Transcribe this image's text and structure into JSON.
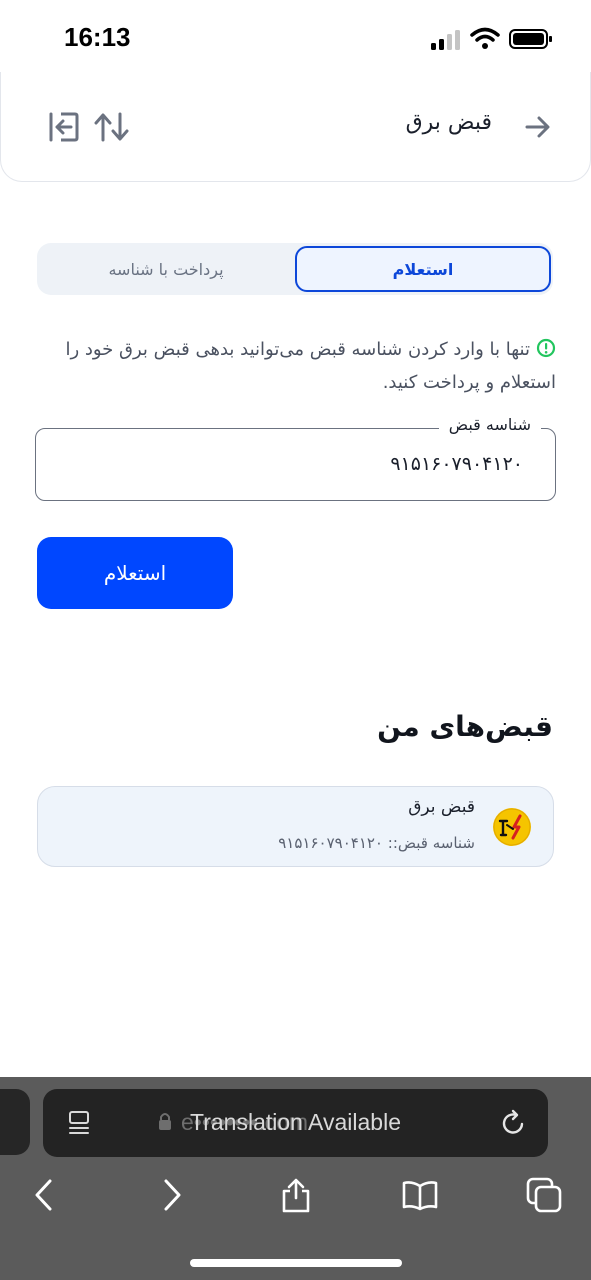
{
  "status_bar": {
    "time": "16:13"
  },
  "header": {
    "title": "قبض برق",
    "back_icon": "arrow-right-icon",
    "sort_icon": "swap-vertical-icon",
    "exit_icon": "logout-icon"
  },
  "tabs": {
    "active": "استعلام",
    "inactive": "پرداخت با شناسه"
  },
  "info": {
    "text": "تنها با وارد کردن شناسه قبض می‌توانید بدهی قبض برق خود را استعلام و پرداخت کنید.",
    "icon": "info-circle-icon"
  },
  "bill_id_field": {
    "label": "شناسه قبض",
    "value": "۹۱۵۱۶۰۷۹۰۴۱۲۰"
  },
  "primary_button": {
    "label": "استعلام"
  },
  "my_bills": {
    "title": "قبض‌های من",
    "items": [
      {
        "name": "قبض برق",
        "id_line": "شناسه قبض:: ۹۱۵۱۶۰۷۹۰۴۱۲۰",
        "icon": "electricity-company-logo"
      }
    ]
  },
  "browser": {
    "url": "e••••••••.com",
    "translation_banner": "Translation Available"
  },
  "colors": {
    "accent": "#0047ff",
    "tab_active_border": "#0d47d9",
    "info_green": "#22c55e",
    "card_bg": "#eef4fb"
  }
}
